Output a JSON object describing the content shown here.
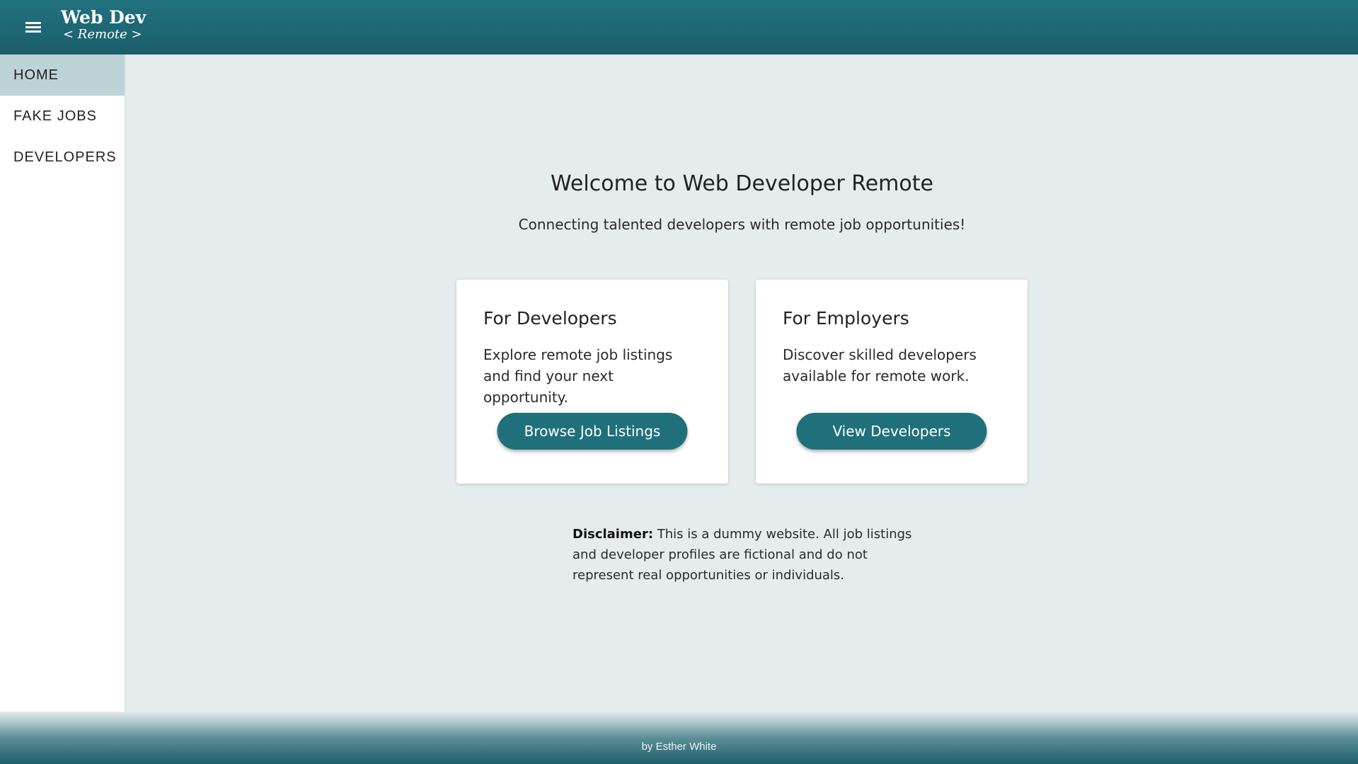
{
  "header": {
    "logo_main": "Web Dev",
    "logo_sub": "< Remote >",
    "menu_icon": "hamburger-menu-icon"
  },
  "sidebar": {
    "items": [
      {
        "label": "HOME",
        "active": true
      },
      {
        "label": "FAKE JOBS",
        "active": false
      },
      {
        "label": "DEVELOPERS",
        "active": false
      }
    ]
  },
  "main": {
    "title": "Welcome to Web Developer Remote",
    "subtitle": "Connecting talented developers with remote job opportunities!",
    "cards": [
      {
        "title": "For Developers",
        "text": "Explore remote job listings and find your next opportunity.",
        "button": "Browse Job Listings"
      },
      {
        "title": "For Employers",
        "text": "Discover skilled developers available for remote work.",
        "button": "View Developers"
      }
    ],
    "disclaimer_label": "Disclaimer:",
    "disclaimer_text": " This is a dummy website. All job listings and developer profiles are fictional and do not represent real opportunities or individuals."
  },
  "footer": {
    "text": "by Esther White"
  },
  "colors": {
    "primary": "#20707c",
    "header": "#1f6b78",
    "background": "#e4ecee",
    "active_nav": "#bed3d7"
  }
}
